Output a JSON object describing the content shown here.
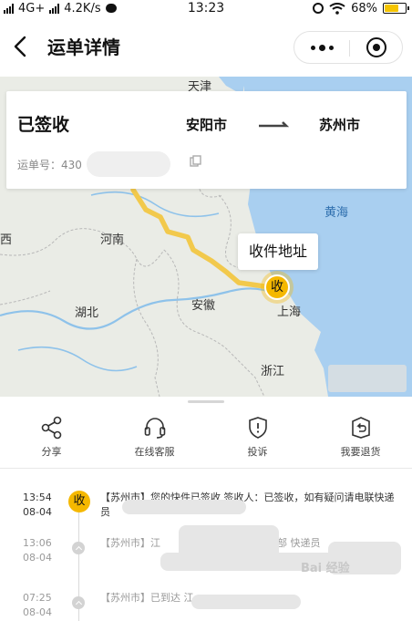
{
  "status_bar": {
    "network": "4G+",
    "speed": "4.2K/s",
    "time": "13:23",
    "battery": "68%",
    "battery_level": 0.68
  },
  "header": {
    "title": "运单详情"
  },
  "map": {
    "labels": [
      "天津",
      "河南",
      "安徽",
      "湖北",
      "上海",
      "浙江",
      "黄海",
      "西"
    ],
    "card": {
      "status": "已签收",
      "from_city": "安阳市",
      "to_city": "苏州市",
      "waybill_label": "运单号：430"
    },
    "bubble": "收件地址",
    "pin": "收",
    "route_color": "#f2c94c"
  },
  "actions": [
    {
      "label": "分享",
      "icon": "share-icon"
    },
    {
      "label": "在线客服",
      "icon": "headset-icon"
    },
    {
      "label": "投诉",
      "icon": "shield-alert-icon"
    },
    {
      "label": "我要退货",
      "icon": "return-box-icon"
    }
  ],
  "timeline": [
    {
      "time": "13:54",
      "date": "08-04",
      "badge": "收",
      "message": "【苏州市】您的快件已签收 签收人：已签收，如有疑问请电联快递员"
    },
    {
      "time": "13:06",
      "date": "08-04",
      "message": "【苏州市】江",
      "message_tail": "部 快递员"
    },
    {
      "time": "07:25",
      "date": "08-04",
      "message": "【苏州市】已到达 江"
    }
  ],
  "watermark": "Bai 经验",
  "colors": {
    "accent": "#f5b800",
    "sea": "#a9cff0"
  }
}
